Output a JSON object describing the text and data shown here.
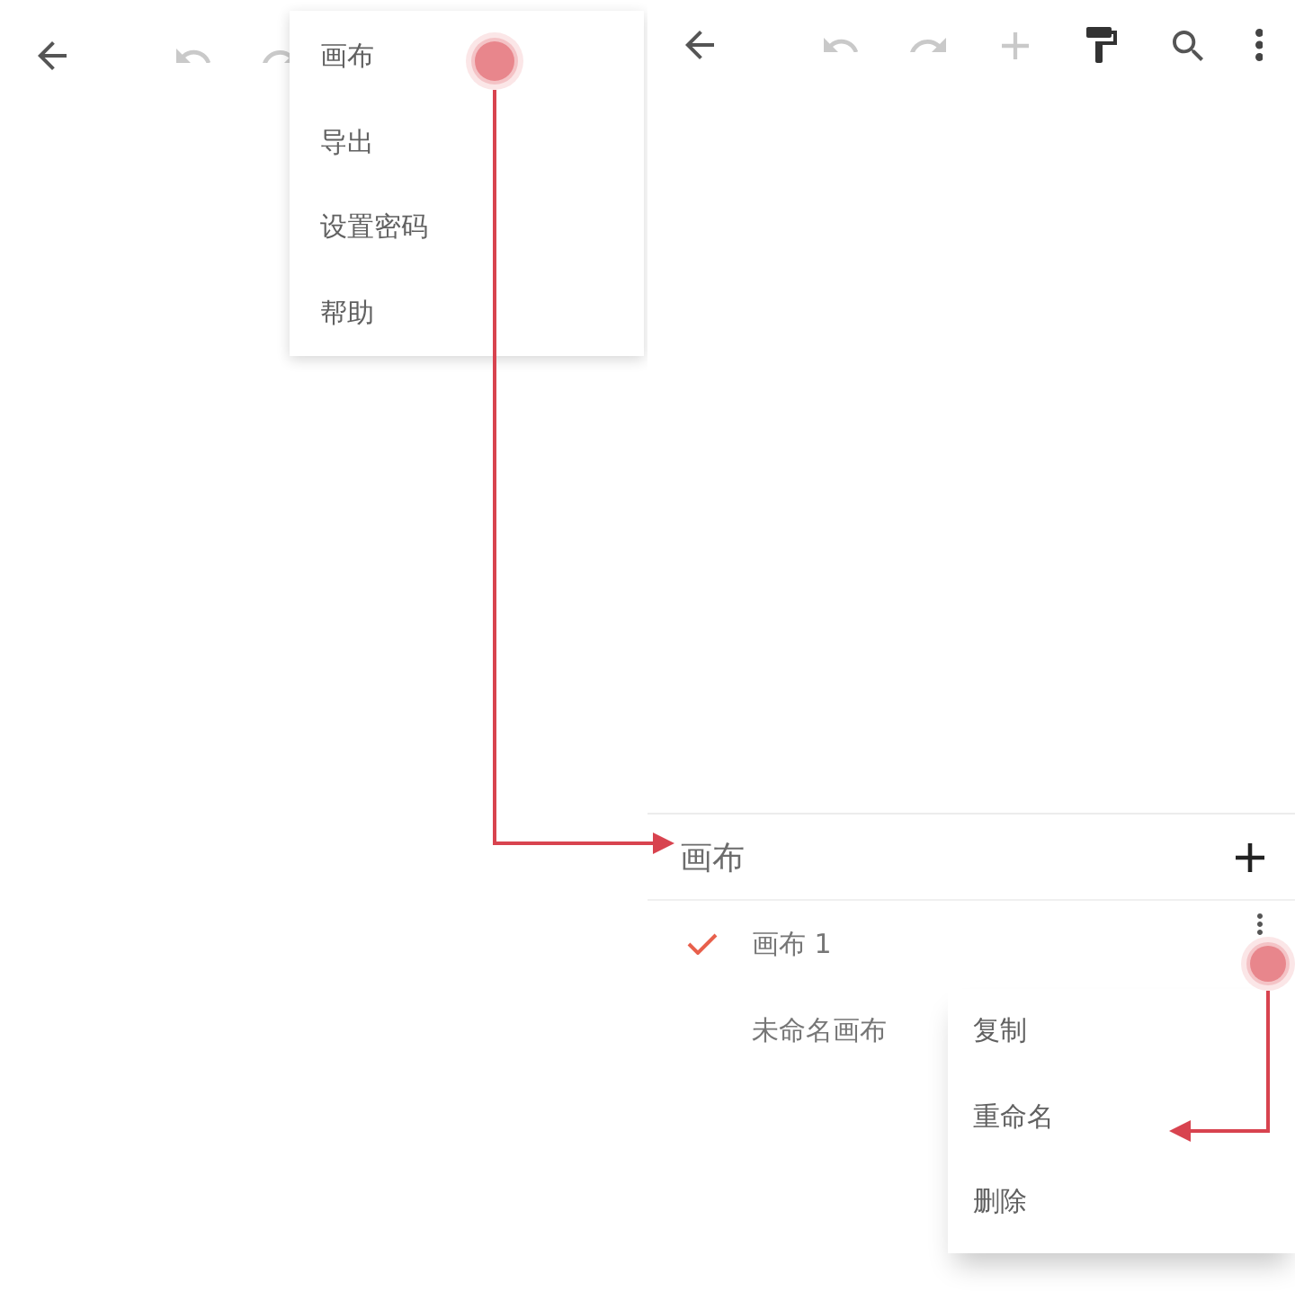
{
  "screens": [
    {
      "toolbar": {
        "buttons": [
          {
            "kind": "back",
            "disabled": false
          },
          {
            "kind": "undo",
            "disabled": true
          },
          {
            "kind": "redo",
            "disabled": true
          }
        ]
      },
      "overflow_menu": {
        "items": [
          {
            "label": "画布",
            "tapped": true
          },
          {
            "label": "导出",
            "tapped": false
          },
          {
            "label": "设置密码",
            "tapped": false
          },
          {
            "label": "帮助",
            "tapped": false
          }
        ]
      }
    },
    {
      "toolbar": {
        "buttons": [
          {
            "kind": "back",
            "disabled": false
          },
          {
            "kind": "undo",
            "disabled": true
          },
          {
            "kind": "redo",
            "disabled": true
          },
          {
            "kind": "add",
            "disabled": true
          },
          {
            "kind": "format_paint",
            "disabled": false
          },
          {
            "kind": "search",
            "disabled": false
          },
          {
            "kind": "more",
            "disabled": false
          }
        ]
      },
      "sheet": {
        "title": "画布",
        "canvases": [
          {
            "name": "画布 1",
            "selected": true,
            "more_tapped": true
          },
          {
            "name": "未命名画布",
            "selected": false,
            "more_tapped": false
          }
        ],
        "context_menu": {
          "items": [
            "复制",
            "重命名",
            "删除"
          ]
        }
      }
    }
  ],
  "annotations": [
    {
      "kind": "elbow_right"
    },
    {
      "kind": "elbow_left"
    }
  ]
}
